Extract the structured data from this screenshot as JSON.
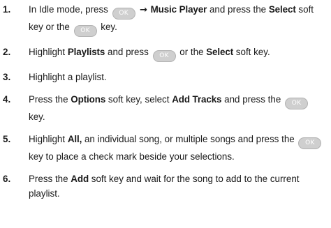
{
  "key_label": "OK",
  "steps": [
    {
      "num": "1.",
      "parts": [
        {
          "t": "text",
          "v": "In Idle mode, press "
        },
        {
          "t": "key"
        },
        {
          "t": "arrow",
          "v": " → "
        },
        {
          "t": "bold",
          "v": "Music Player"
        },
        {
          "t": "text",
          "v": " and press the "
        },
        {
          "t": "bold",
          "v": "Select"
        },
        {
          "t": "text",
          "v": " soft key or the "
        },
        {
          "t": "key"
        },
        {
          "t": "text",
          "v": " key."
        }
      ]
    },
    {
      "num": "2.",
      "parts": [
        {
          "t": "text",
          "v": "Highlight "
        },
        {
          "t": "bold",
          "v": "Playlists"
        },
        {
          "t": "text",
          "v": " and press "
        },
        {
          "t": "key"
        },
        {
          "t": "text",
          "v": " or the "
        },
        {
          "t": "bold",
          "v": "Select"
        },
        {
          "t": "text",
          "v": " soft key."
        }
      ]
    },
    {
      "num": "3.",
      "parts": [
        {
          "t": "text",
          "v": "Highlight a playlist."
        }
      ]
    },
    {
      "num": "4.",
      "parts": [
        {
          "t": "text",
          "v": "Press the "
        },
        {
          "t": "bold",
          "v": "Options"
        },
        {
          "t": "text",
          "v": " soft key, select "
        },
        {
          "t": "bold",
          "v": "Add Tracks"
        },
        {
          "t": "text",
          "v": " and press the "
        },
        {
          "t": "key"
        },
        {
          "t": "text",
          "v": " key."
        }
      ]
    },
    {
      "num": "5.",
      "parts": [
        {
          "t": "text",
          "v": "Highlight "
        },
        {
          "t": "bold",
          "v": "All,"
        },
        {
          "t": "text",
          "v": " an individual song, or multiple songs and press the "
        },
        {
          "t": "key"
        },
        {
          "t": "text",
          "v": " key to place a check mark beside your selections."
        }
      ]
    },
    {
      "num": "6.",
      "parts": [
        {
          "t": "text",
          "v": "Press the "
        },
        {
          "t": "bold",
          "v": "Add"
        },
        {
          "t": "text",
          "v": " soft key and wait for the song to add to the current playlist."
        }
      ]
    }
  ]
}
